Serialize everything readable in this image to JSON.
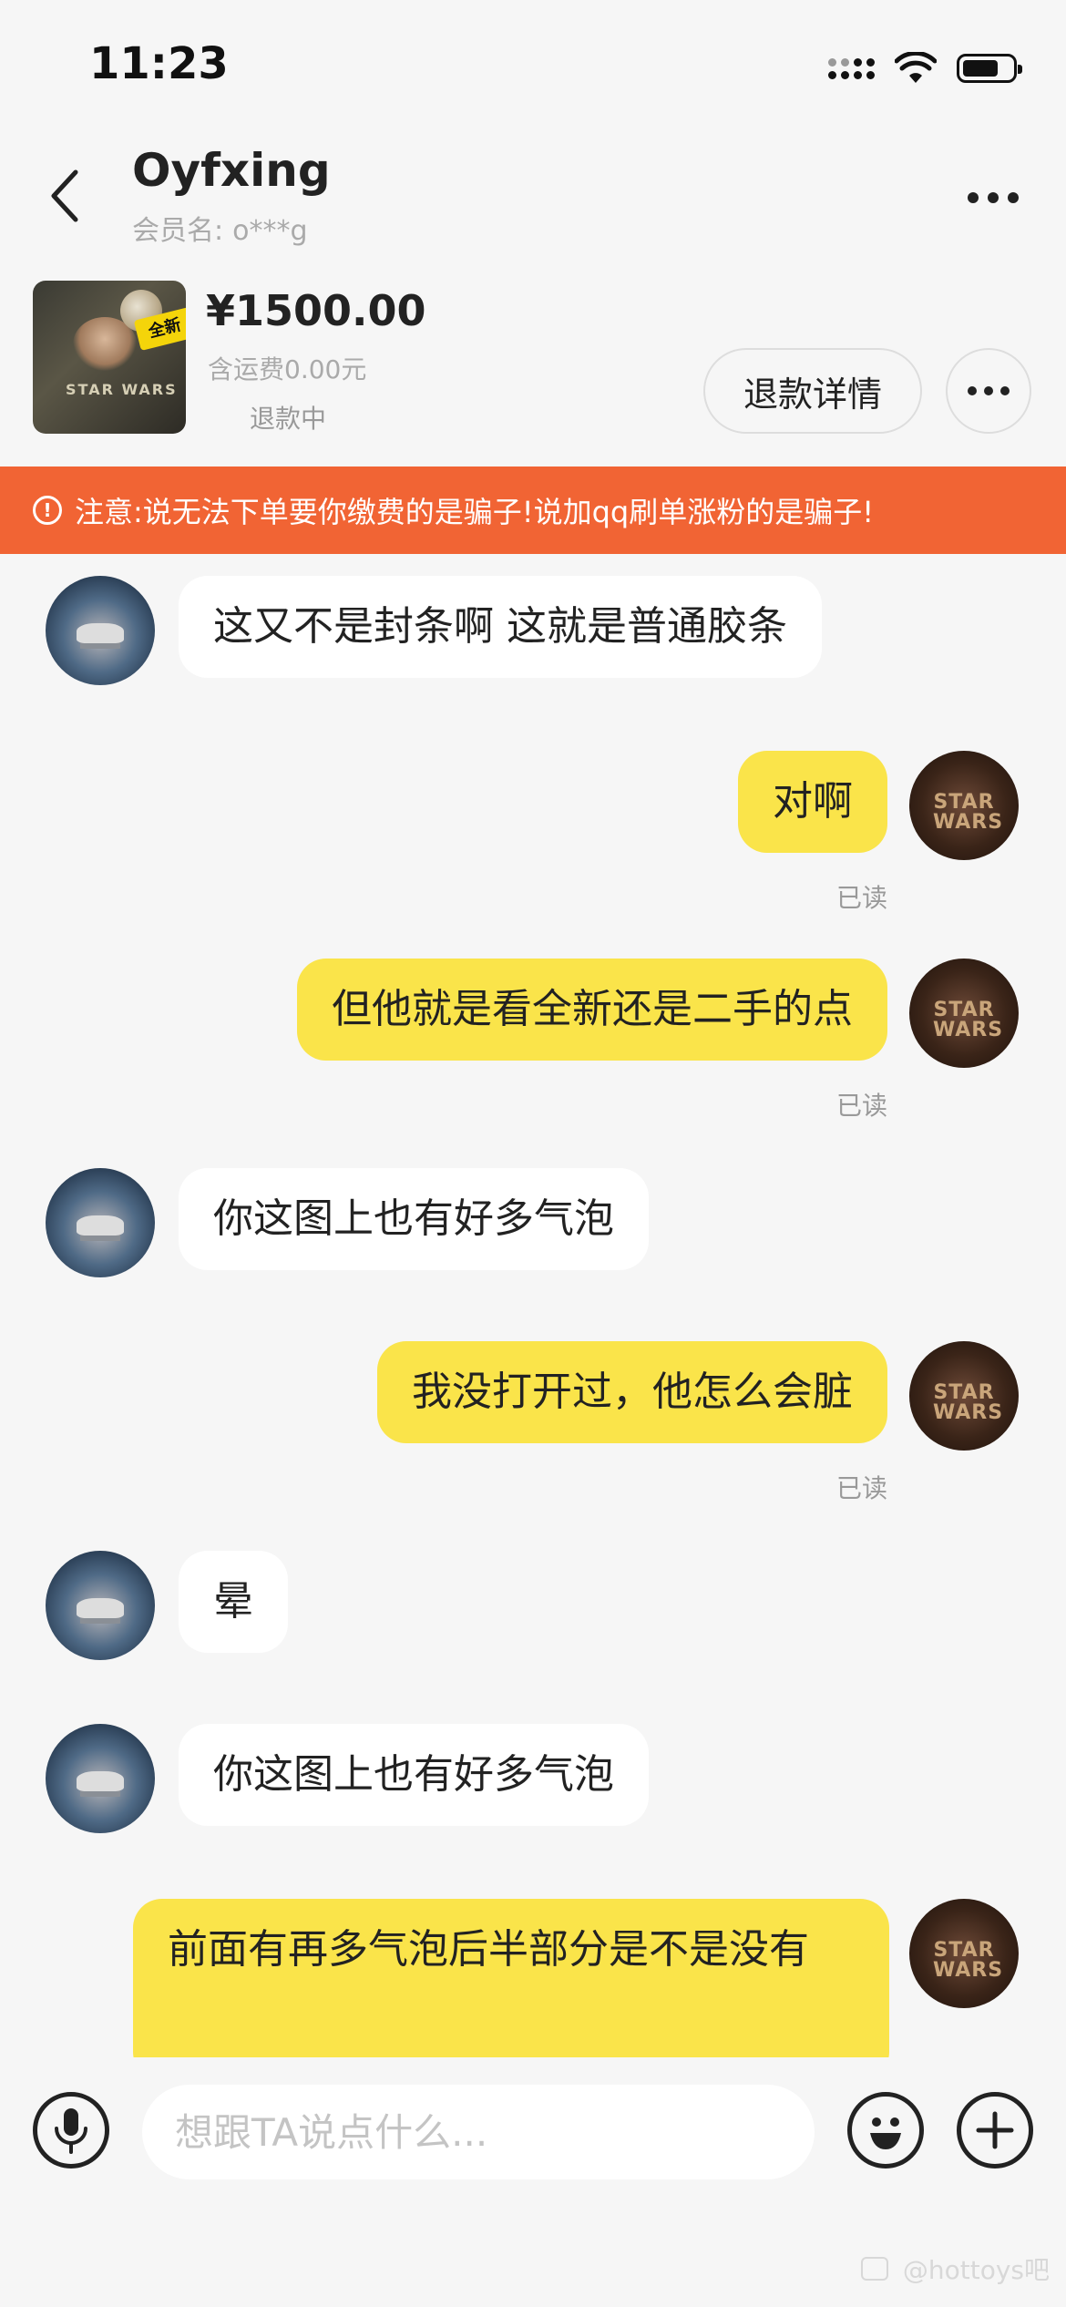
{
  "status_bar": {
    "time": "11:23",
    "battery_level": 0.7,
    "icons": [
      "signal-icon",
      "wifi-icon",
      "battery-icon"
    ]
  },
  "header": {
    "title": "Oyfxing",
    "subtitle_label": "会员名:",
    "subtitle_value": "o***g"
  },
  "product": {
    "price": "¥1500.00",
    "shipping": "含运费0.00元",
    "status": "退款中",
    "refund_button": "退款详情"
  },
  "warning": {
    "text": "注意:说无法下单要你缴费的是骗子!说加qq刷单涨粉的是骗子!"
  },
  "messages": [
    {
      "from": "them",
      "text": "这又不是封条啊  这就是普通胶条"
    },
    {
      "from": "me",
      "text": "对啊",
      "status": "已读"
    },
    {
      "from": "me",
      "text": "但他就是看全新还是二手的点",
      "status": "已读"
    },
    {
      "from": "them",
      "text": "你这图上也有好多气泡"
    },
    {
      "from": "me",
      "text": "我没打开过，他怎么会脏",
      "status": "已读"
    },
    {
      "from": "them",
      "text": "晕"
    },
    {
      "from": "them",
      "text": "你这图上也有好多气泡"
    },
    {
      "from": "me",
      "text": "前面有再多气泡后半部分是不是没有"
    }
  ],
  "avatar_text": "STAR WARS",
  "product_thumb_text": {
    "badge": "全新",
    "logo": "STAR WARS"
  },
  "input": {
    "placeholder": "想跟TA说点什么..."
  },
  "watermark": "@hottoys吧",
  "colors": {
    "accent_yellow": "#fae44a",
    "warning_orange": "#f16434",
    "background": "#f6f6f6"
  }
}
